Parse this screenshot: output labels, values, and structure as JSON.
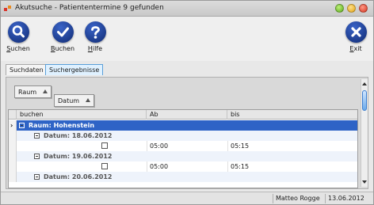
{
  "window": {
    "title": "Akutsuche - Patiententermine 9 gefunden"
  },
  "toolbar": {
    "search_label_u": "S",
    "search_label_rest": "uchen",
    "book_label_u": "B",
    "book_label_rest": "uchen",
    "help_label_u": "H",
    "help_label_rest": "ilfe",
    "exit_label_u": "E",
    "exit_label_rest": "xit"
  },
  "tabs": [
    {
      "label": "Suchdaten",
      "active": false
    },
    {
      "label": "Suchergebnisse",
      "active": true
    }
  ],
  "grouping": {
    "chips": [
      {
        "label": "Raum"
      },
      {
        "label": "Datum"
      }
    ]
  },
  "grid": {
    "columns": [
      "buchen",
      "Ab",
      "bis"
    ],
    "group1": {
      "label": "Raum: Hohenstein"
    },
    "rows": [
      {
        "type": "group",
        "label": "Datum: 18.06.2012"
      },
      {
        "type": "data",
        "ab": "05:00",
        "bis": "05:15"
      },
      {
        "type": "group",
        "label": "Datum: 19.06.2012"
      },
      {
        "type": "data",
        "ab": "05:00",
        "bis": "05:15"
      },
      {
        "type": "group",
        "label": "Datum: 20.06.2012"
      }
    ]
  },
  "status": {
    "user": "Matteo Rogge",
    "date": "13.06.2012"
  },
  "colors": {
    "accent": "#2e63c6",
    "toolbar_icon": "#1a3a94"
  },
  "icons": {
    "search": "search-icon",
    "book": "check-icon",
    "help": "help-icon",
    "exit": "close-icon"
  }
}
